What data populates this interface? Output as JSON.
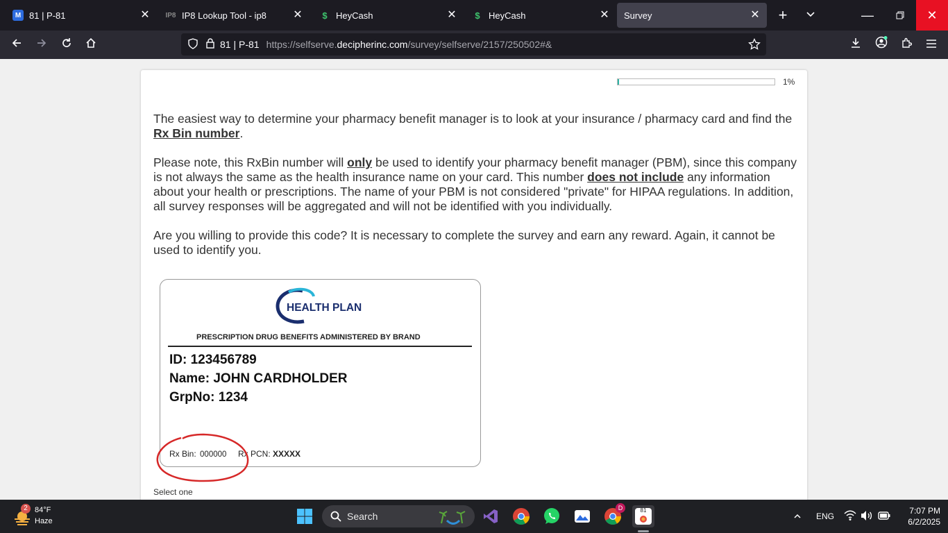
{
  "tabs": [
    {
      "title": "81 | P-81",
      "icon": "app-icon"
    },
    {
      "title": "IP8 Lookup Tool - ip8",
      "icon": "ip8-icon"
    },
    {
      "title": "HeyCash",
      "icon": "dollar-icon"
    },
    {
      "title": "HeyCash",
      "icon": "dollar-icon"
    },
    {
      "title": "Survey",
      "icon": "none"
    }
  ],
  "urlbar": {
    "site_label": "81 | P-81",
    "url_prefix": "https://selfserve.",
    "url_domain": "decipherinc.com",
    "url_path": "/survey/selfserve/2157/250502#&"
  },
  "survey": {
    "progress_percent": 1,
    "progress_text": "1%",
    "p1_text": "The easiest way to determine your pharmacy benefit manager is to look at your insurance / pharmacy card and find the ",
    "p1_bold": "Rx Bin number",
    "p1_end": ".",
    "p2_a": "Please note, this RxBin number will ",
    "p2_only": "only",
    "p2_b": " be used to identify your pharmacy benefit manager (PBM), since this company is not always the same as the health insurance name on your card. This number ",
    "p2_bold": "does not include",
    "p2_c": " any information about your health or prescriptions. The name of your PBM is not considered \"private\" for HIPAA regulations. In addition, all survey responses will be aggregated and will not be identified with you individually.",
    "p3": "Are you willing to provide this code? It is necessary to complete the survey and earn any reward. Again, it cannot be used to identify you.",
    "select_one": "Select one"
  },
  "card": {
    "logo_text": "HEALTH PLAN",
    "subtitle": "PRESCRIPTION DRUG BENEFITS ADMINISTERED BY BRAND",
    "id_line": "ID: 123456789",
    "name_line": "Name: JOHN CARDHOLDER",
    "grp_line": "GrpNo: 1234",
    "rxbin_label": "Rx Bin:",
    "rxbin_value": "000000",
    "rxpcn_label": "Rx PCN:",
    "rxpcn_value": "XXXXX"
  },
  "taskbar": {
    "weather_temp": "84°F",
    "weather_desc": "Haze",
    "weather_badge": "2",
    "search_placeholder": "Search",
    "lang": "ENG",
    "time": "7:07 PM",
    "date": "6/2/2025",
    "chrome_badge": "D",
    "active_app_badge": "81"
  },
  "colors": {
    "accent": "#2fb3a5",
    "close_red": "#e81123",
    "ellipse_red": "#d62828"
  }
}
